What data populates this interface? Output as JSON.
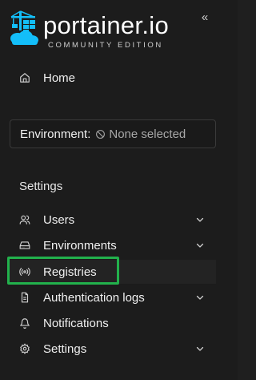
{
  "brand": {
    "name": "portainer.io",
    "edition": "COMMUNITY EDITION",
    "logo_icon": "portainer-crane-logo",
    "color": "#13bef9"
  },
  "collapse": {
    "icon": "double-chevron-left-icon",
    "glyph": "«"
  },
  "nav": {
    "home": {
      "label": "Home",
      "icon": "home-icon"
    }
  },
  "environment": {
    "label": "Environment:",
    "value": "None selected",
    "icon": "ban-icon"
  },
  "settings_section": {
    "title": "Settings",
    "items": [
      {
        "label": "Users",
        "icon": "users-icon",
        "expandable": true
      },
      {
        "label": "Environments",
        "icon": "hdd-icon",
        "expandable": true
      },
      {
        "label": "Registries",
        "icon": "radio-icon",
        "expandable": false,
        "highlighted": true
      },
      {
        "label": "Authentication logs",
        "icon": "file-text-icon",
        "expandable": true
      },
      {
        "label": "Notifications",
        "icon": "bell-icon",
        "expandable": false
      },
      {
        "label": "Settings",
        "icon": "gear-icon",
        "expandable": true
      }
    ]
  },
  "colors": {
    "background": "#1c1c1c",
    "text": "#f0f0f0",
    "muted_text": "#a8a8a8",
    "highlight_outline": "#22b14c"
  }
}
